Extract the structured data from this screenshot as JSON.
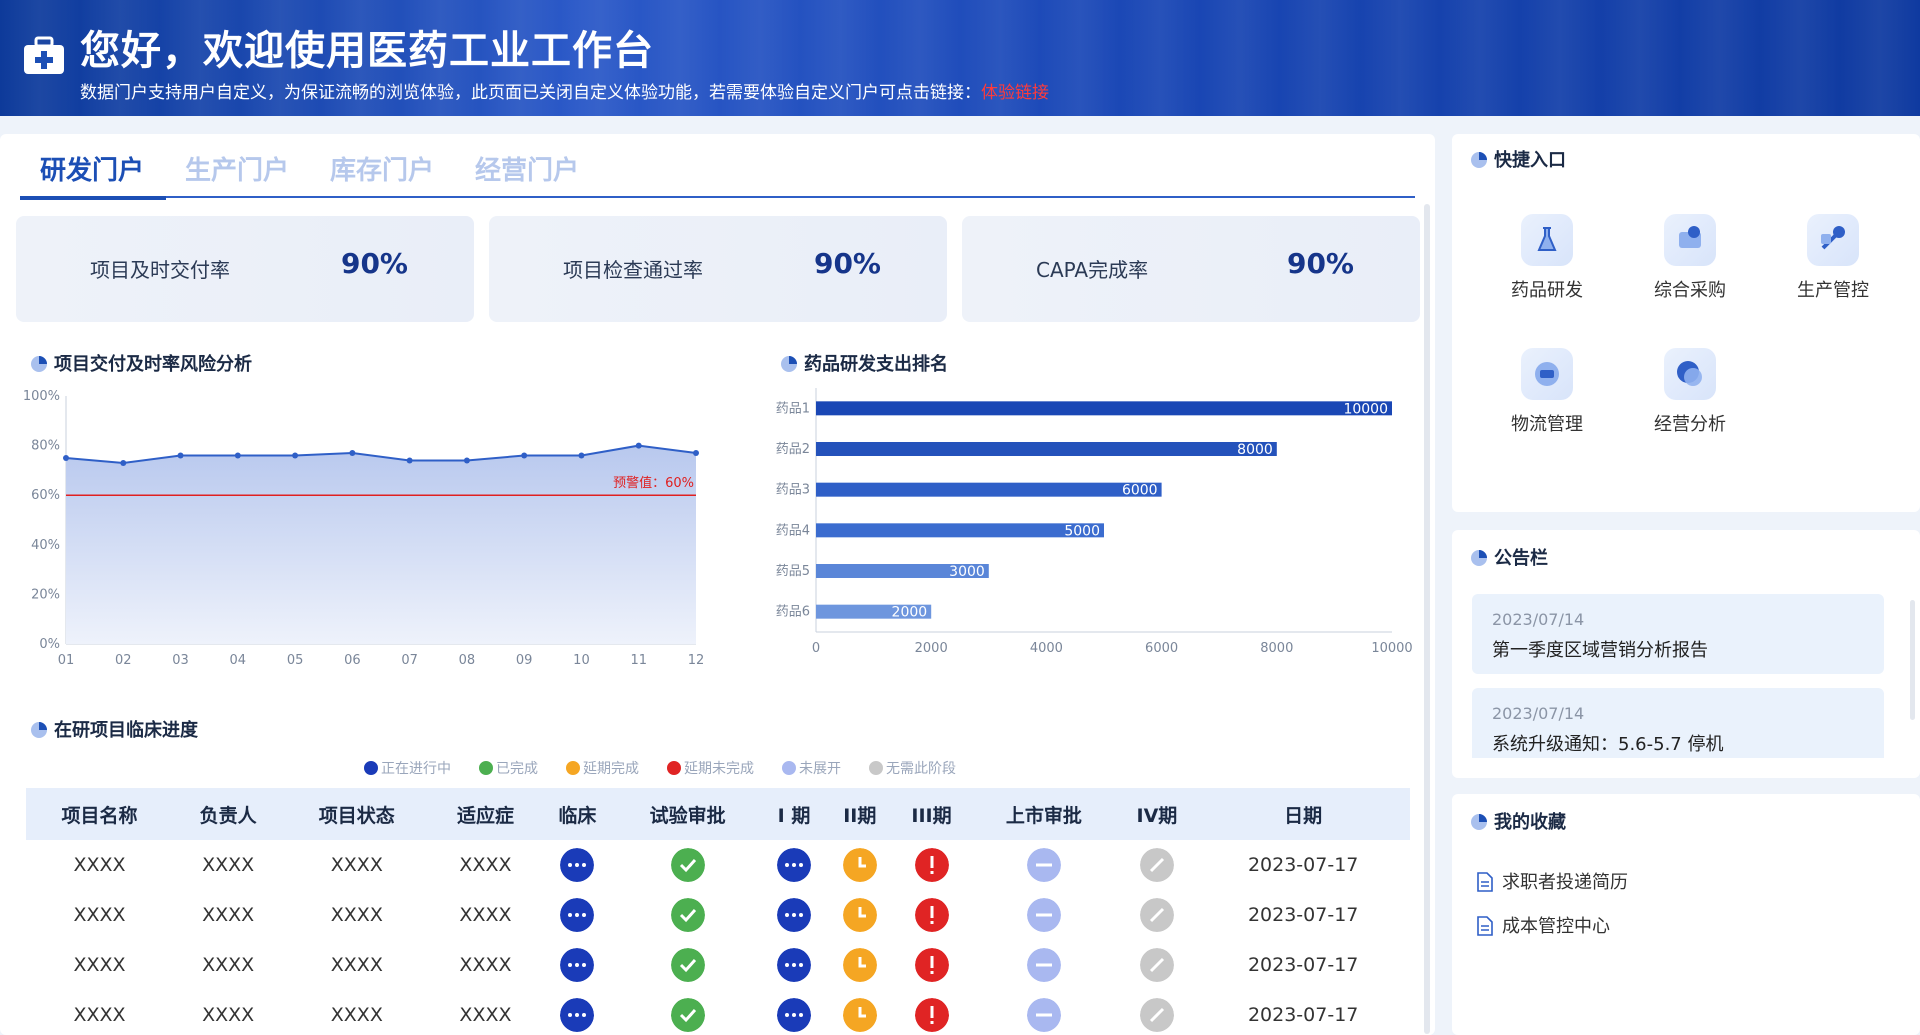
{
  "banner": {
    "title": "您好，欢迎使用医药工业工作台",
    "subtitle": "数据门户支持用户自定义，为保证流畅的浏览体验，此页面已关闭自定义体验功能，若需要体验自定义门户可点击链接：",
    "link": "体验链接",
    "icon": "medical-kit-icon"
  },
  "tabs": [
    "研发门户",
    "生产门户",
    "库存门户",
    "经营门户"
  ],
  "kpis": [
    {
      "label": "项目及时交付率",
      "value": "90%"
    },
    {
      "label": "项目检查通过率",
      "value": "90%"
    },
    {
      "label": "CAPA完成率",
      "value": "90%"
    }
  ],
  "sections": {
    "line_title": "项目交付及时率风险分析",
    "bar_title": "药品研发支出排名",
    "table_title": "在研项目临床进度"
  },
  "chart_data": [
    {
      "type": "area",
      "x": [
        "01",
        "02",
        "03",
        "04",
        "05",
        "06",
        "07",
        "08",
        "09",
        "10",
        "11",
        "12"
      ],
      "series": [
        {
          "values": [
            75,
            73,
            76,
            76,
            76,
            77,
            74,
            74,
            76,
            76,
            80,
            77
          ]
        }
      ],
      "ylim": [
        0,
        100
      ],
      "yticks": [
        "0%",
        "20%",
        "40%",
        "60%",
        "80%",
        "100%"
      ],
      "threshold": {
        "value": 60,
        "label": "预警值：60%",
        "color": "#e02020"
      },
      "color": "#2f5fc7"
    },
    {
      "type": "bar",
      "orientation": "horizontal",
      "categories": [
        "药品1",
        "药品2",
        "药品3",
        "药品4",
        "药品5",
        "药品6"
      ],
      "values": [
        10000,
        8000,
        6000,
        5000,
        3000,
        2000
      ],
      "xlim": [
        0,
        10000
      ],
      "xticks": [
        "0",
        "2000",
        "4000",
        "6000",
        "8000",
        "10000"
      ],
      "colors": [
        "#1a47b5",
        "#2452bb",
        "#2f5fc7",
        "#3b6ccf",
        "#5a86d8",
        "#6e96de"
      ]
    }
  ],
  "legend": [
    {
      "label": "正在进行中",
      "color": "#1a3bb8"
    },
    {
      "label": "已完成",
      "color": "#4caf50"
    },
    {
      "label": "延期完成",
      "color": "#f5a623"
    },
    {
      "label": "延期未完成",
      "color": "#e02424"
    },
    {
      "label": "未展开",
      "color": "#a9b8f0"
    },
    {
      "label": "无需此阶段",
      "color": "#c8c8c8"
    }
  ],
  "table": {
    "headers": [
      "项目名称",
      "负责人",
      "项目状态",
      "适应症",
      "临床",
      "试验审批",
      "I 期",
      "II期",
      "III期",
      "上市审批",
      "IV期",
      "日期"
    ],
    "rows": [
      {
        "name": "XXXX",
        "owner": "XXXX",
        "status": "XXXX",
        "indication": "XXXX",
        "date": "2023-07-17"
      },
      {
        "name": "XXXX",
        "owner": "XXXX",
        "status": "XXXX",
        "indication": "XXXX",
        "date": "2023-07-17"
      },
      {
        "name": "XXXX",
        "owner": "XXXX",
        "status": "XXXX",
        "indication": "XXXX",
        "date": "2023-07-17"
      },
      {
        "name": "XXXX",
        "owner": "XXXX",
        "status": "XXXX",
        "indication": "XXXX",
        "date": "2023-07-17"
      }
    ],
    "stage_states": [
      "ongoing",
      "done",
      "ongoing",
      "delayed-done",
      "delayed-undone",
      "not-started",
      "not-needed"
    ]
  },
  "quick": {
    "title": "快捷入口",
    "items": [
      {
        "label": "药品研发",
        "icon": "flask-icon"
      },
      {
        "label": "综合采购",
        "icon": "cart-icon"
      },
      {
        "label": "生产管控",
        "icon": "tools-icon"
      },
      {
        "label": "物流管理",
        "icon": "truck-icon"
      },
      {
        "label": "经营分析",
        "icon": "analysis-icon"
      }
    ]
  },
  "notices": {
    "title": "公告栏",
    "items": [
      {
        "date": "2023/07/14",
        "text": "第一季度区域营销分析报告"
      },
      {
        "date": "2023/07/14",
        "text": "系统升级通知：5.6-5.7 停机"
      }
    ]
  },
  "favorites": {
    "title": "我的收藏",
    "items": [
      "求职者投递简历",
      "成本管控中心"
    ]
  }
}
